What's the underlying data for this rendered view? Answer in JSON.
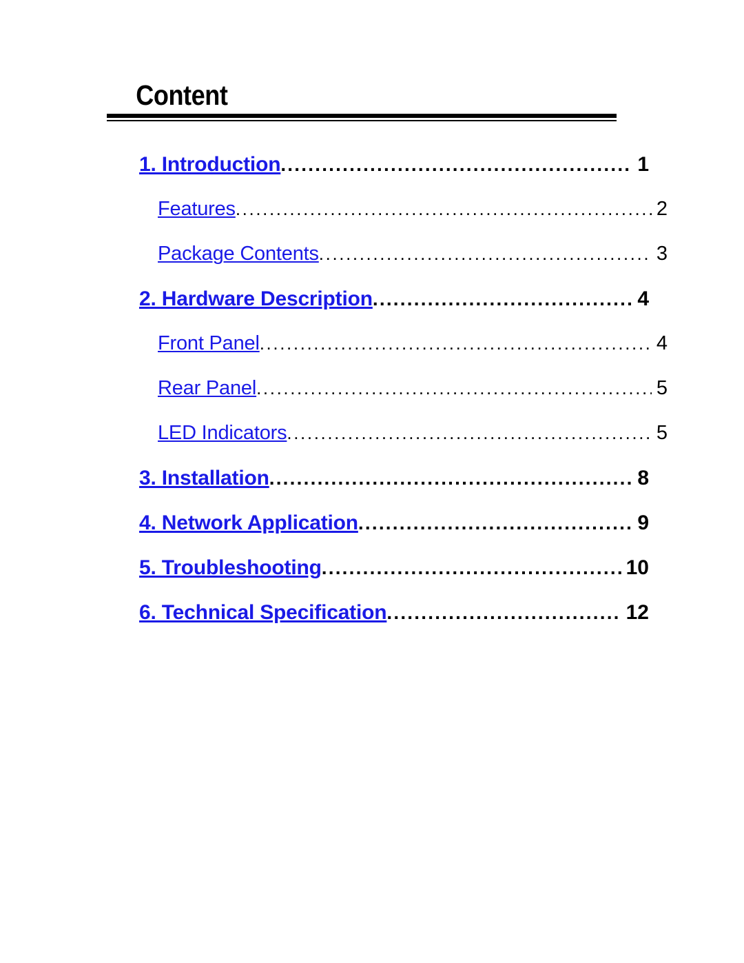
{
  "document": {
    "title": "Content",
    "link_color": "#1a1ae6",
    "text_color": "#000000",
    "background_color": "#ffffff"
  },
  "toc": {
    "entries": [
      {
        "label": "1. Introduction",
        "page": "1",
        "level": 1
      },
      {
        "label": "Features",
        "page": "2",
        "level": 2
      },
      {
        "label": "Package Contents",
        "page": "3",
        "level": 2
      },
      {
        "label": "2. Hardware Description",
        "page": "4",
        "level": 1
      },
      {
        "label": "Front Panel",
        "page": "4",
        "level": 2
      },
      {
        "label": "Rear Panel",
        "page": "5",
        "level": 2
      },
      {
        "label": "LED Indicators",
        "page": "5",
        "level": 2
      },
      {
        "label": "3. Installation",
        "page": "8",
        "level": 1
      },
      {
        "label": "4. Network Application",
        "page": "9",
        "level": 1
      },
      {
        "label": "5. Troubleshooting",
        "page": "10",
        "level": 1
      },
      {
        "label": "6. Technical Specification",
        "page": "12",
        "level": 1
      }
    ]
  }
}
